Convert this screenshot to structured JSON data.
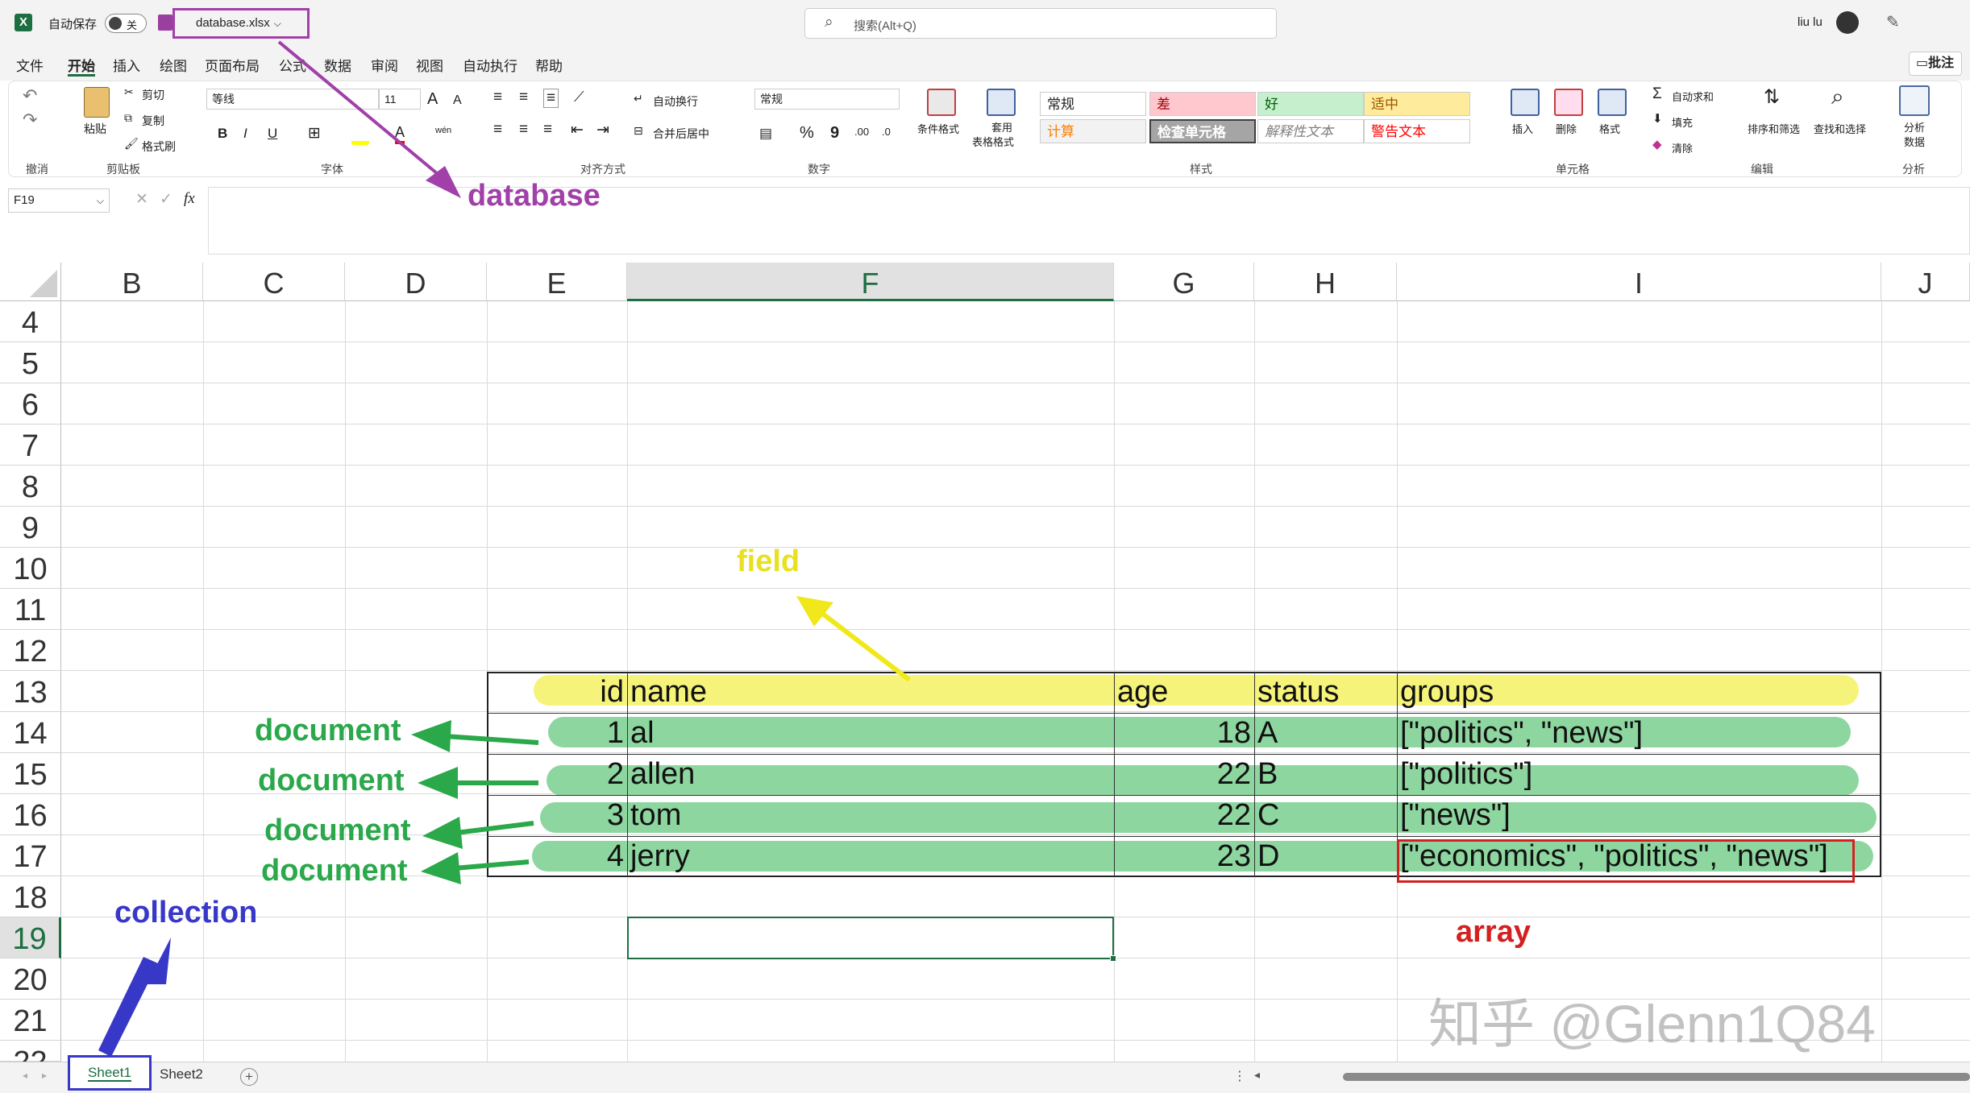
{
  "title_bar": {
    "autosave_label": "自动保存",
    "autosave_state": "关",
    "filename": "database.xlsx",
    "search_placeholder": "搜索(Alt+Q)",
    "user_name": "liu lu"
  },
  "menu": {
    "items": [
      "文件",
      "开始",
      "插入",
      "绘图",
      "页面布局",
      "公式",
      "数据",
      "审阅",
      "视图",
      "自动执行",
      "帮助"
    ],
    "active": "开始",
    "comments_label": "批注"
  },
  "ribbon": {
    "undo_group_label": "撤消",
    "clipboard": {
      "paste": "粘贴",
      "cut": "剪切",
      "copy": "复制",
      "format_painter": "格式刷",
      "label": "剪贴板"
    },
    "font": {
      "name": "等线",
      "size": "11",
      "label": "字体",
      "grow": "A",
      "shrink": "A",
      "bold": "B",
      "italic": "I",
      "underline": "U",
      "font_color": "A",
      "wen": "wén"
    },
    "alignment": {
      "wrap": "自动换行",
      "merge": "合并后居中",
      "label": "对齐方式"
    },
    "number": {
      "format": "常规",
      "percent": "%",
      "comma": "9",
      "label": "数字"
    },
    "styles": {
      "conditional": "条件格式",
      "table_format_1": "套用",
      "table_format_2": "表格格式",
      "label": "样式",
      "cells": [
        {
          "text": "常规",
          "bg": "#ffffff",
          "color": "#222222"
        },
        {
          "text": "差",
          "bg": "#ffc7ce",
          "color": "#9c0006"
        },
        {
          "text": "好",
          "bg": "#c6efce",
          "color": "#006100"
        },
        {
          "text": "适中",
          "bg": "#ffeb9c",
          "color": "#9c5700"
        },
        {
          "text": "计算",
          "bg": "#f2f2f2",
          "color": "#fa7d00"
        },
        {
          "text": "检查单元格",
          "bg": "#a5a5a5",
          "color": "#ffffff"
        },
        {
          "text": "解释性文本",
          "bg": "#ffffff",
          "color": "#7f7f7f"
        },
        {
          "text": "警告文本",
          "bg": "#ffffff",
          "color": "#ff0000"
        }
      ]
    },
    "cells_group": {
      "insert": "插入",
      "delete": "删除",
      "format": "格式",
      "label": "单元格"
    },
    "editing": {
      "autosum": "自动求和",
      "fill": "填充",
      "clear": "清除",
      "sort_filter": "排序和筛选",
      "find_select": "查找和选择",
      "label": "编辑"
    },
    "analysis": {
      "analyze_1": "分析",
      "analyze_2": "数据",
      "label": "分析"
    }
  },
  "formula_bar": {
    "name_box": "F19",
    "fx": "fx",
    "cancel": "✕",
    "enter": "✓"
  },
  "grid": {
    "columns": [
      "B",
      "C",
      "D",
      "E",
      "F",
      "G",
      "H",
      "I",
      "J"
    ],
    "selected_column": "F",
    "rows": [
      "4",
      "5",
      "6",
      "7",
      "8",
      "9",
      "10",
      "11",
      "12",
      "13",
      "14",
      "15",
      "16",
      "17",
      "18",
      "19",
      "20",
      "21",
      "22"
    ],
    "selected_row": "19",
    "selected_cell": "F19",
    "table": {
      "headers": [
        "id",
        "name",
        "age",
        "status",
        "groups"
      ],
      "records": [
        [
          "1",
          "al",
          "18",
          "A",
          "[\"politics\", \"news\"]"
        ],
        [
          "2",
          "allen",
          "22",
          "B",
          "[\"politics\"]"
        ],
        [
          "3",
          "tom",
          "22",
          "C",
          "[\"news\"]"
        ],
        [
          "4",
          "jerry",
          "23",
          "D",
          "[\"economics\", \"politics\", \"news\"]"
        ]
      ]
    }
  },
  "annotations": {
    "database": "database",
    "field": "field",
    "document": "document",
    "collection": "collection",
    "array": "array",
    "colors": {
      "database": "#a040a8",
      "field": "#e8e020",
      "document": "#2aa84a",
      "collection": "#3838c8",
      "array": "#d42020"
    }
  },
  "watermark": "知乎 @Glenn1Q84",
  "sheet_tabs": {
    "tabs": [
      "Sheet1",
      "Sheet2"
    ],
    "active": "Sheet1",
    "add": "+"
  }
}
